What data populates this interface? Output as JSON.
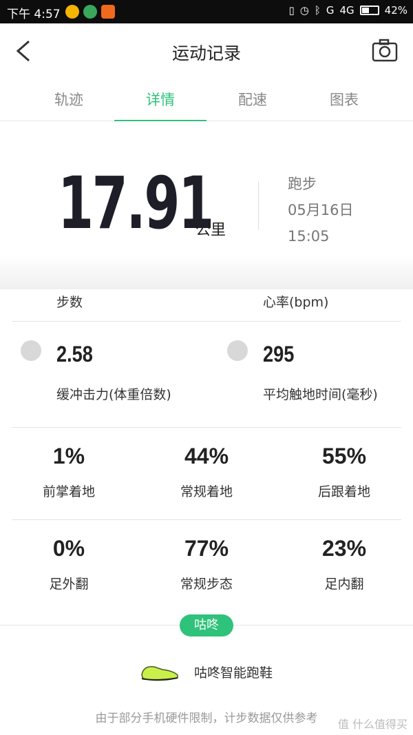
{
  "status_bar": {
    "time": "下午 4:57",
    "network": "4G",
    "signal_label": "G",
    "battery": "42%"
  },
  "header": {
    "title": "运动记录"
  },
  "tabs": [
    {
      "label": "轨迹",
      "active": false
    },
    {
      "label": "详情",
      "active": true
    },
    {
      "label": "配速",
      "active": false
    },
    {
      "label": "图表",
      "active": false
    }
  ],
  "summary": {
    "distance": "17.91",
    "unit": "公里",
    "sport": "跑步",
    "date": "05月16日",
    "time": "15:05"
  },
  "partial_row": {
    "left_label": "步数",
    "right_label": "心率(bpm)"
  },
  "impact_row": {
    "left": {
      "value": "2.58",
      "label": "缓冲击力(体重倍数)",
      "icon": "footprint-icon"
    },
    "right": {
      "value": "295",
      "label": "平均触地时间(毫秒)",
      "icon": "contact-icon"
    }
  },
  "strike_row": [
    {
      "value": "1%",
      "label": "前掌着地"
    },
    {
      "value": "44%",
      "label": "常规着地"
    },
    {
      "value": "55%",
      "label": "后跟着地"
    }
  ],
  "gait_row": [
    {
      "value": "0%",
      "label": "足外翻"
    },
    {
      "value": "77%",
      "label": "常规步态"
    },
    {
      "value": "23%",
      "label": "足内翻"
    }
  ],
  "brand": {
    "pill": "咕咚",
    "product": "咕咚智能跑鞋",
    "disclaimer": "由于部分手机硬件限制，计步数据仅供参考",
    "watermark": "值 什么值得买"
  },
  "colors": {
    "accent": "#2ec27a",
    "statusbar_bg": "#0d0d0d"
  }
}
